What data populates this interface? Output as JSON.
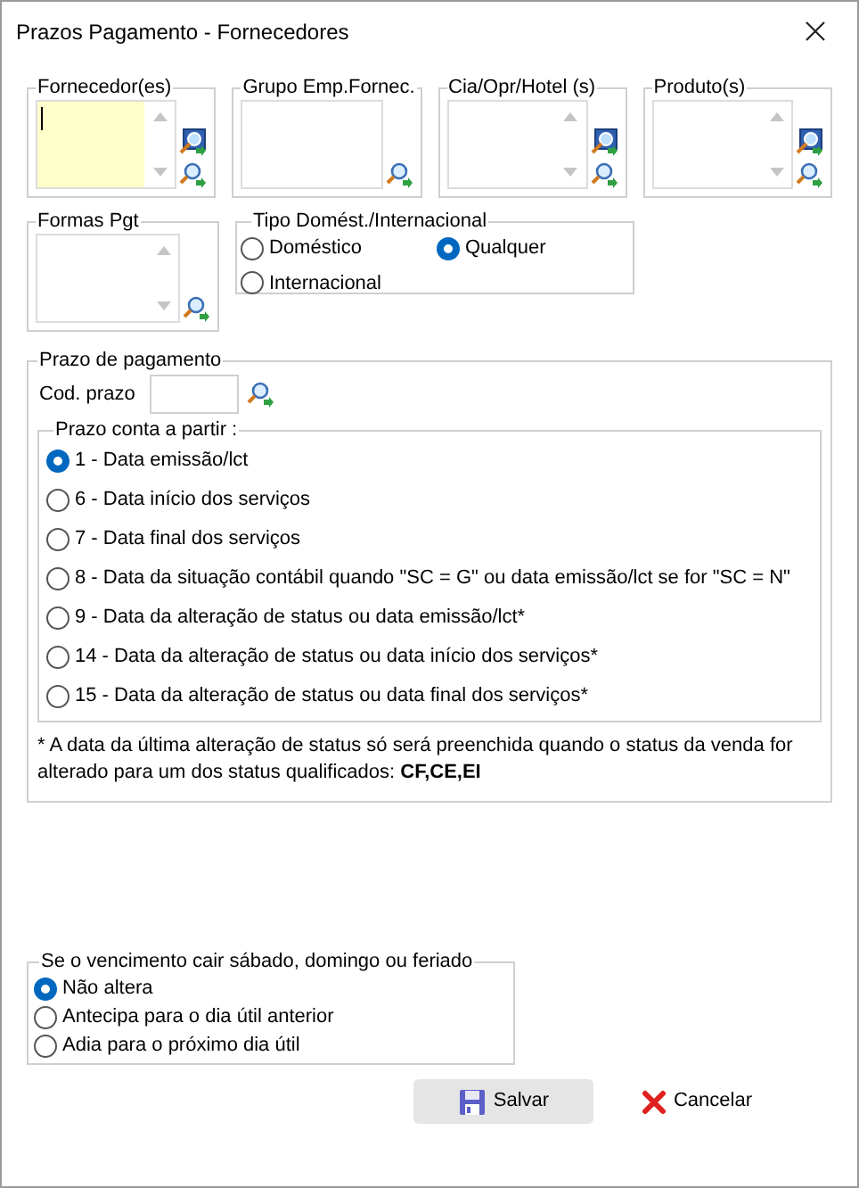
{
  "window": {
    "title": "Prazos Pagamento - Fornecedores"
  },
  "filter_lists": [
    {
      "label": "Fornecedor(es)",
      "focused": true,
      "scrollbar": true,
      "picker": true
    },
    {
      "label": "Grupo Emp.Fornec.",
      "focused": false,
      "scrollbar": false,
      "picker": false
    },
    {
      "label": "Cia/Opr/Hotel (s)",
      "focused": false,
      "scrollbar": true,
      "picker": true
    },
    {
      "label": "Produto(s)",
      "focused": false,
      "scrollbar": true,
      "picker": true
    },
    {
      "label": "Formas Pgt",
      "focused": false,
      "scrollbar": true,
      "picker": false
    }
  ],
  "tipo": {
    "label": "Tipo Domést./Internacional",
    "options": [
      {
        "label": "Doméstico",
        "selected": false
      },
      {
        "label": "Qualquer",
        "selected": true
      },
      {
        "label": "Internacional",
        "selected": false
      }
    ]
  },
  "prazo": {
    "label": "Prazo de pagamento",
    "cod_label": "Cod. prazo",
    "partir": {
      "label": "Prazo conta a partir :",
      "options": [
        {
          "label": "1 - Data emissão/lct",
          "selected": true
        },
        {
          "label": "6 - Data início dos serviços",
          "selected": false
        },
        {
          "label": "7 - Data final dos serviços",
          "selected": false
        },
        {
          "label": "8 - Data da situação contábil quando \"SC = G\" ou data emissão/lct se for \"SC = N\"",
          "selected": false
        },
        {
          "label": "9 - Data da alteração de status ou data emissão/lct*",
          "selected": false
        },
        {
          "label": "14 - Data da alteração de status ou data início dos serviços*",
          "selected": false
        },
        {
          "label": "15 - Data da alteração de status ou data final dos serviços*",
          "selected": false
        }
      ]
    },
    "note": "* A data da última alteração de status só será preenchida quando o status da venda for alterado para um dos status qualificados: **CF,CE,EI**"
  },
  "vencimento": {
    "label": "Se o vencimento cair sábado, domingo ou feriado",
    "options": [
      {
        "label": "Não altera",
        "selected": true
      },
      {
        "label": "Antecipa para o dia útil anterior",
        "selected": false
      },
      {
        "label": "Adia para o próximo dia útil",
        "selected": false
      }
    ]
  },
  "buttons": [
    {
      "label": "Salvar",
      "kind": "save",
      "highlighted": true
    },
    {
      "label": "Cancelar",
      "kind": "cancel",
      "highlighted": false
    }
  ]
}
